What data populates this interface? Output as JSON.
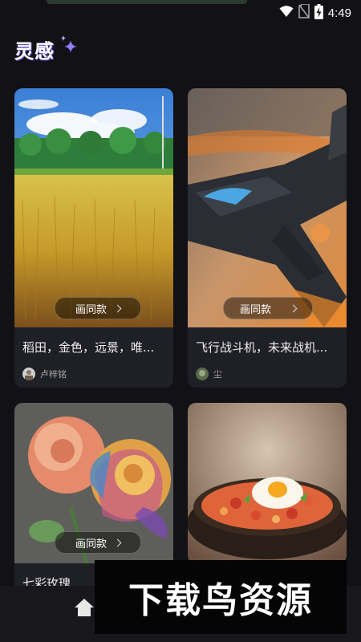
{
  "status": {
    "time": "4:49"
  },
  "header": {
    "title": "灵感"
  },
  "cards": [
    {
      "title": "稻田，金色，远景，唯...",
      "remix_label": "画同款",
      "author": "卢梓铭"
    },
    {
      "title": "飞行战斗机，未来战机...",
      "remix_label": "画同款",
      "author": "尘"
    },
    {
      "title": "七彩玫瑰",
      "remix_label": "画同款"
    },
    {
      "title": ""
    }
  ],
  "watermark": {
    "text": "下载鸟资源"
  }
}
